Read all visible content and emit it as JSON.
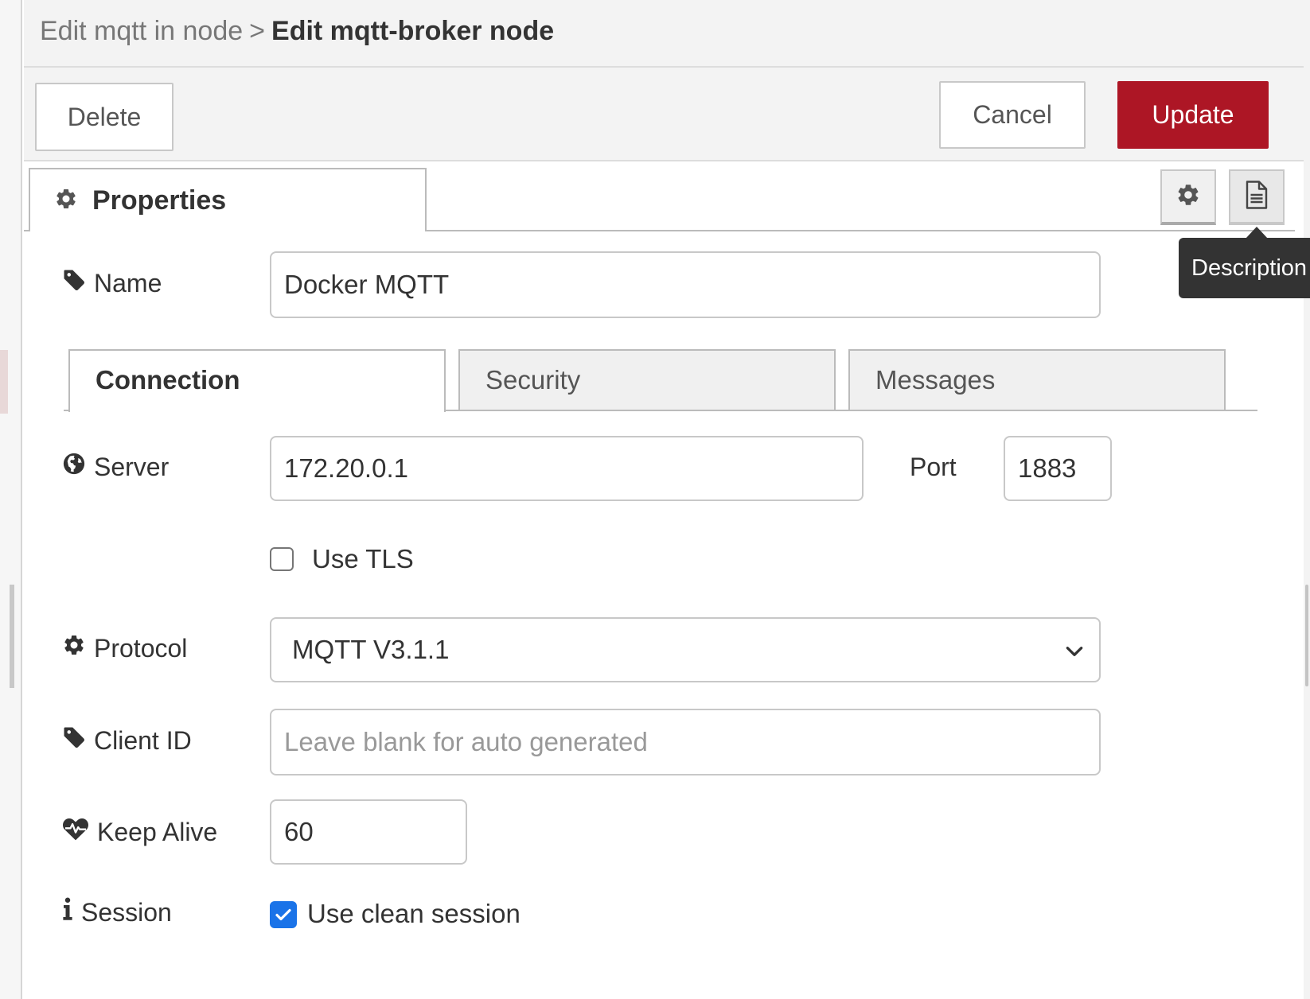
{
  "header": {
    "breadcrumb_parent": "Edit mqtt in node",
    "breadcrumb_separator": ">",
    "breadcrumb_current": "Edit mqtt-broker node"
  },
  "toolbar": {
    "delete_label": "Delete",
    "cancel_label": "Cancel",
    "update_label": "Update",
    "update_color": "#ad1625"
  },
  "properties_tab": {
    "label": "Properties",
    "icon": "gear-icon"
  },
  "side_tools": {
    "settings_icon": "gear-icon",
    "description_icon": "document-icon",
    "tooltip": "Description"
  },
  "name_row": {
    "label": "Name",
    "icon": "tag-icon",
    "value": "Docker MQTT"
  },
  "config_tabs": [
    {
      "label": "Connection",
      "active": true
    },
    {
      "label": "Security",
      "active": false
    },
    {
      "label": "Messages",
      "active": false
    }
  ],
  "connection": {
    "server": {
      "label": "Server",
      "icon": "globe-icon",
      "value": "172.20.0.1"
    },
    "port": {
      "label": "Port",
      "value": "1883"
    },
    "use_tls": {
      "label": "Use TLS",
      "checked": false
    },
    "protocol": {
      "label": "Protocol",
      "icon": "gear-icon",
      "selected": "MQTT V3.1.1"
    },
    "client_id": {
      "label": "Client ID",
      "icon": "tag-icon",
      "value": "",
      "placeholder": "Leave blank for auto generated"
    },
    "keep_alive": {
      "label": "Keep Alive",
      "icon": "heartbeat-icon",
      "value": "60"
    },
    "session": {
      "label": "Session",
      "icon": "info-icon",
      "checkbox_label": "Use clean session",
      "checked": true,
      "checkbox_color": "#1a73e8"
    }
  }
}
